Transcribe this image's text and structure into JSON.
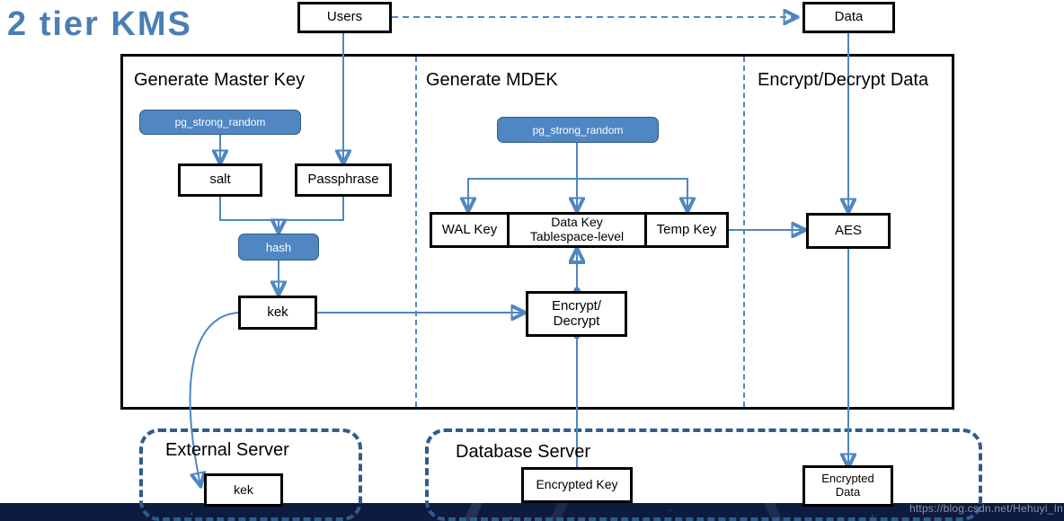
{
  "title": "2 tier KMS",
  "watermark": "https://blog.csdn.net/Hehuyi_In",
  "colors": {
    "title_blue": "#4a7fb5",
    "rounded_box_fill": "#5086c1",
    "rounded_box_border": "#2f5c8a",
    "connector_blue": "#5086c1",
    "box_border": "#000000",
    "navy_band": "#0d1b3e"
  },
  "top_nodes": {
    "users": "Users",
    "data": "Data"
  },
  "columns": [
    {
      "label": "Generate Master Key"
    },
    {
      "label": "Generate MDEK"
    },
    {
      "label": "Encrypt/Decrypt Data"
    }
  ],
  "nodes": {
    "pg_strong_random_left": "pg_strong_random",
    "pg_strong_random_mid": "pg_strong_random",
    "salt": "salt",
    "passphrase": "Passphrase",
    "hash": "hash",
    "kek": "kek",
    "wal_key": "WAL Key",
    "data_key_line1": "Data Key",
    "data_key_line2": "Tablespace-level",
    "temp_key": "Temp Key",
    "encrypt_decrypt_line1": "Encrypt/",
    "encrypt_decrypt_line2": "Decrypt",
    "aes": "AES"
  },
  "servers": [
    {
      "label": "External Server",
      "node": "kek"
    },
    {
      "label": "Database Server",
      "node": "Encrypted Key"
    }
  ],
  "bottom_nodes": {
    "external_kek": "kek",
    "encrypted_key": "Encrypted Key",
    "encrypted_data_line1": "Encrypted",
    "encrypted_data_line2": "Data"
  }
}
